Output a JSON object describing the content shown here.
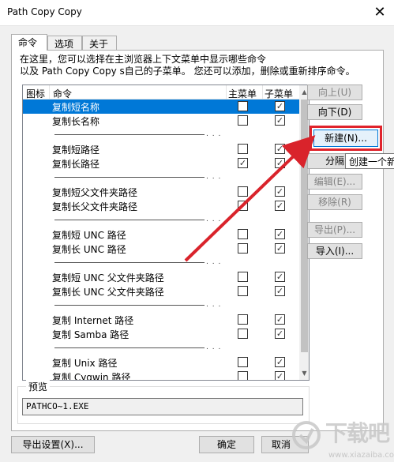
{
  "window": {
    "title": "Path Copy Copy",
    "close_glyph": "✕"
  },
  "tabs": [
    {
      "label": "命令",
      "active": true
    },
    {
      "label": "选项",
      "active": false
    },
    {
      "label": "关于",
      "active": false
    }
  ],
  "description": {
    "line1": "在这里，您可以选择在主浏览器上下文菜单中显示哪些命令",
    "line2": "以及 Path Copy Copy s自己的子菜单。 您还可以添加，删除或重新排序命令。"
  },
  "list": {
    "headers": {
      "icon": "图标",
      "command": "命令",
      "main": "主菜单",
      "sub": "子菜单"
    },
    "separator_dots": ". . .",
    "rows": [
      {
        "name": "复制短名称",
        "main": false,
        "sub": true,
        "selected": true
      },
      {
        "name": "复制长名称",
        "main": false,
        "sub": true
      },
      {
        "separator": true
      },
      {
        "name": "复制短路径",
        "main": false,
        "sub": true
      },
      {
        "name": "复制长路径",
        "main": true,
        "sub": true
      },
      {
        "separator": true
      },
      {
        "name": "复制短父文件夹路径",
        "main": false,
        "sub": true
      },
      {
        "name": "复制长父文件夹路径",
        "main": false,
        "sub": true
      },
      {
        "separator": true
      },
      {
        "name": "复制短 UNC 路径",
        "main": false,
        "sub": true
      },
      {
        "name": "复制长 UNC 路径",
        "main": false,
        "sub": true
      },
      {
        "separator": true
      },
      {
        "name": "复制短 UNC 父文件夹路径",
        "main": false,
        "sub": true
      },
      {
        "name": "复制长 UNC 父文件夹路径",
        "main": false,
        "sub": true
      },
      {
        "separator": true
      },
      {
        "name": "复制 Internet 路径",
        "main": false,
        "sub": true
      },
      {
        "name": "复制 Samba 路径",
        "main": false,
        "sub": true
      },
      {
        "separator": true
      },
      {
        "name": "复制 Unix 路径",
        "main": false,
        "sub": true
      },
      {
        "name": "复制 Cygwin 路径",
        "main": false,
        "sub": true
      }
    ]
  },
  "side_buttons": {
    "up": "向上(U)",
    "down": "向下(D)",
    "new": "新建(N)...",
    "separator": "分隔",
    "edit": "编辑(E)...",
    "remove": "移除(R)",
    "export": "导出(P)...",
    "import": "导入(I)..."
  },
  "tooltip": "创建一个新",
  "preview": {
    "label": "预览",
    "value": "PATHCO~1.EXE"
  },
  "footer": {
    "export_settings": "导出设置(X)...",
    "ok": "确定",
    "cancel": "取消"
  },
  "watermark": {
    "text": "下载吧",
    "url": "www.xiazaiba.com"
  },
  "colors": {
    "selection": "#0078d7",
    "highlight_box": "#e0232b",
    "arrow": "#d9232b"
  }
}
